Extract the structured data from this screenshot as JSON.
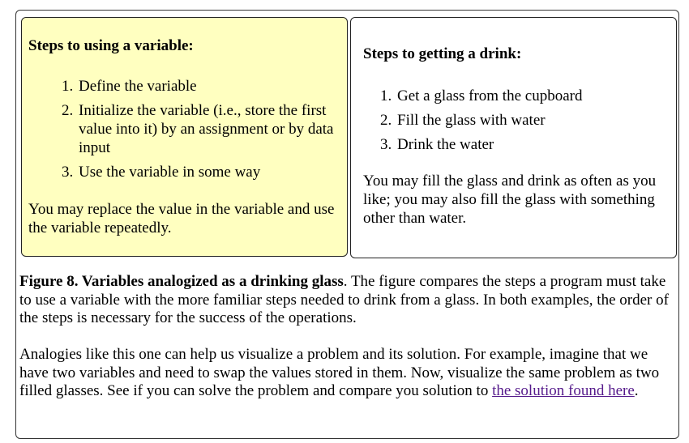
{
  "left_panel": {
    "heading": "Steps to using a variable:",
    "steps": [
      "Define the variable",
      "Initialize the variable (i.e., store the first value into it) by an assignment or by data input",
      "Use the variable in some way"
    ],
    "note": "You may replace the value in the variable and use the variable repeatedly."
  },
  "right_panel": {
    "heading": "Steps to getting a drink:",
    "steps": [
      "Get a glass from the cupboard",
      "Fill the glass with water",
      "Drink the water"
    ],
    "note": "You may fill the glass and drink as often as you like; you may also fill the glass with something other than water."
  },
  "caption": {
    "label": "Figure 8. Variables analogized as a drinking glass",
    "text": ". The figure compares the steps a program must take to use a variable with the more familiar steps needed to drink from a glass. In both examples, the order of the steps is necessary for the success of the operations."
  },
  "analogy": {
    "text": "Analogies like this one can help us visualize a problem and its solution. For example, imagine that we have two variables and need to swap the values stored in them. Now, visualize the same problem as two filled glasses. See if you can solve the problem and compare you solution to ",
    "link_text": "the solution found here",
    "after_link": "."
  },
  "colors": {
    "left_panel_background": "#ffffc0",
    "link_visited": "#551a8b"
  }
}
